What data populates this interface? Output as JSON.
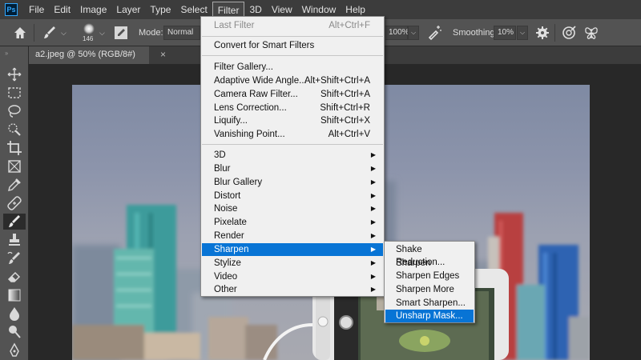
{
  "app": {
    "logo_text": "Ps"
  },
  "menubar": {
    "items": [
      "File",
      "Edit",
      "Image",
      "Layer",
      "Type",
      "Select",
      "Filter",
      "3D",
      "View",
      "Window",
      "Help"
    ],
    "active_index": 6
  },
  "options_bar": {
    "brush_size": "146",
    "mode_label": "Mode:",
    "mode_value": "Normal",
    "flow_value": "100%",
    "smoothing_label": "Smoothing:",
    "smoothing_value": "10%"
  },
  "document_tab": {
    "title": "a2.jpeg @ 50% (RGB/8#)",
    "close": "×"
  },
  "toolbar": {
    "tools": [
      "move-tool",
      "marquee-tool",
      "lasso-tool",
      "quick-selection-tool",
      "crop-tool",
      "frame-tool",
      "eyedropper-tool",
      "healing-brush-tool",
      "brush-tool",
      "clone-stamp-tool",
      "history-brush-tool",
      "eraser-tool",
      "gradient-tool",
      "blur-tool",
      "dodge-tool",
      "pen-tool"
    ],
    "selected": "brush-tool"
  },
  "filter_menu": {
    "items": [
      {
        "label": "Last Filter",
        "shortcut": "Alt+Ctrl+F",
        "disabled": true
      },
      {
        "label": "Convert for Smart Filters"
      },
      {
        "label": "Filter Gallery..."
      },
      {
        "label": "Adaptive Wide Angle...",
        "shortcut": "Alt+Shift+Ctrl+A"
      },
      {
        "label": "Camera Raw Filter...",
        "shortcut": "Shift+Ctrl+A"
      },
      {
        "label": "Lens Correction...",
        "shortcut": "Shift+Ctrl+R"
      },
      {
        "label": "Liquify...",
        "shortcut": "Shift+Ctrl+X"
      },
      {
        "label": "Vanishing Point...",
        "shortcut": "Alt+Ctrl+V"
      },
      {
        "label": "3D",
        "submenu": true
      },
      {
        "label": "Blur",
        "submenu": true
      },
      {
        "label": "Blur Gallery",
        "submenu": true
      },
      {
        "label": "Distort",
        "submenu": true
      },
      {
        "label": "Noise",
        "submenu": true
      },
      {
        "label": "Pixelate",
        "submenu": true
      },
      {
        "label": "Render",
        "submenu": true
      },
      {
        "label": "Sharpen",
        "submenu": true,
        "highlighted": true
      },
      {
        "label": "Stylize",
        "submenu": true
      },
      {
        "label": "Video",
        "submenu": true
      },
      {
        "label": "Other",
        "submenu": true
      }
    ],
    "arrow": "▶"
  },
  "sharpen_submenu": {
    "items": [
      {
        "label": "Shake Reduction..."
      },
      {
        "label": "Sharpen"
      },
      {
        "label": "Sharpen Edges"
      },
      {
        "label": "Sharpen More"
      },
      {
        "label": "Smart Sharpen..."
      },
      {
        "label": "Unsharp Mask...",
        "highlighted": true
      }
    ]
  },
  "colors": {
    "menu_highlight": "#0874d5",
    "menubar_bg": "#3c3c3c",
    "panel_bg": "#535353",
    "workspace_bg": "#282828"
  }
}
